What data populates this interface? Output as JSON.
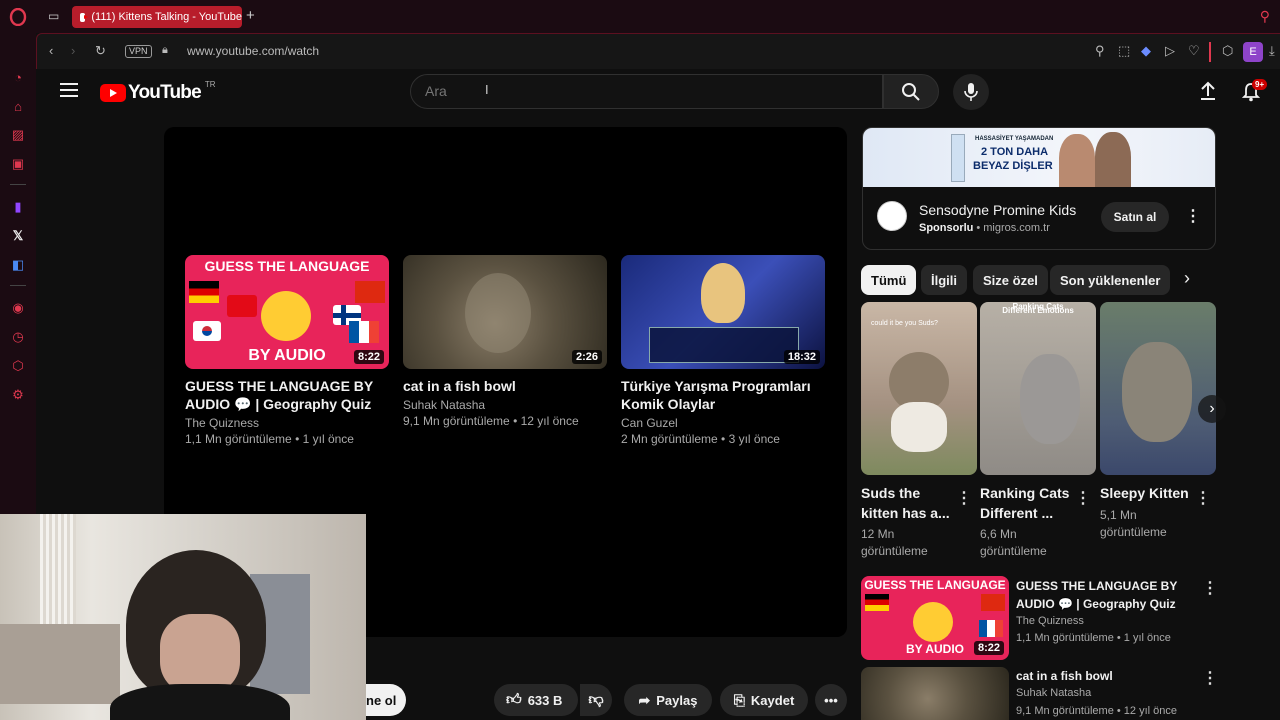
{
  "browser": {
    "tab_title": "(111) Kittens Talking - YouTube",
    "url": "www.youtube.com/watch",
    "vpn_label": "VPN",
    "profile_initial": "E",
    "sidebar_icons": [
      "opera-logo-icon",
      "aria-icon",
      "crypto-wallet-icon",
      "pinboard-icon",
      "messenger-icon",
      "twitch-icon",
      "x-icon",
      "translate-icon",
      "player-icon",
      "history-icon",
      "extensions-icon",
      "settings-icon"
    ]
  },
  "youtube": {
    "logo_text": "YouTube",
    "region": "TR",
    "search_placeholder": "Ara",
    "notif_badge": "9+"
  },
  "endscreen": [
    {
      "title": "GUESS THE LANGUAGE BY AUDIO 💬 | Geography Quiz",
      "channel": "The Quizness",
      "meta": "1,1 Mn görüntüleme • 1 yıl önce",
      "duration": "8:22"
    },
    {
      "title": "cat in a fish bowl",
      "channel": "Suhak Natasha",
      "meta": "9,1 Mn görüntüleme • 12 yıl önce",
      "duration": "2:26"
    },
    {
      "title": "Türkiye Yarışma Programları Komik Olaylar",
      "channel": "Can Guzel",
      "meta": "2 Mn görüntüleme • 3 yıl önce",
      "duration": "18:32"
    }
  ],
  "thumb_text": {
    "guess_top": "GUESS THE LANGUAGE",
    "guess_bottom": "BY AUDIO",
    "ranking_top": "Ranking Cats",
    "ranking_sub": "Different Emotions",
    "kitten_caption": "could it be you Suds?",
    "ad_line1": "HASSASİYET YAŞAMADAN",
    "ad_line2": "2 TON DAHA",
    "ad_line3": "BEYAZ DİŞLER"
  },
  "ad": {
    "title": "Sensodyne Promine Kids",
    "sponsored": "Sponsorlu",
    "domain": "migros.com.tr",
    "button": "Satın al"
  },
  "chips": [
    "Tümü",
    "İlgili",
    "Size özel",
    "Son yüklenenler"
  ],
  "shorts": [
    {
      "title_line1": "Suds the",
      "title_line2": "kitten has a...",
      "views_line1": "12 Mn",
      "views_line2": "görüntüleme"
    },
    {
      "title_line1": "Ranking Cats",
      "title_line2": "Different ...",
      "views_line1": "6,6 Mn",
      "views_line2": "görüntüleme"
    },
    {
      "title_line1": "Sleepy Kitten",
      "title_line2": "",
      "views_line1": "5,1 Mn",
      "views_line2": "görüntüleme"
    }
  ],
  "related": [
    {
      "title_line1": "GUESS THE LANGUAGE BY",
      "title_line2": "AUDIO 💬 | Geography Quiz",
      "channel": "The Quizness",
      "meta": "1,1 Mn görüntüleme • 1 yıl önce",
      "duration": "8:22"
    },
    {
      "title_line1": "cat in a fish bowl",
      "title_line2": "",
      "channel": "Suhak Natasha",
      "meta": "9,1 Mn görüntüleme • 12 yıl önce",
      "duration": ""
    }
  ],
  "actions": {
    "subscribe_partial": "ne ol",
    "likes": "633 B",
    "share": "Paylaş",
    "save": "Kaydet"
  },
  "colors": {
    "opera_red": "#e0384f",
    "yt_red": "#ff0000",
    "bg": "#0f0f0f",
    "chip_active": "#f1f1f1"
  }
}
